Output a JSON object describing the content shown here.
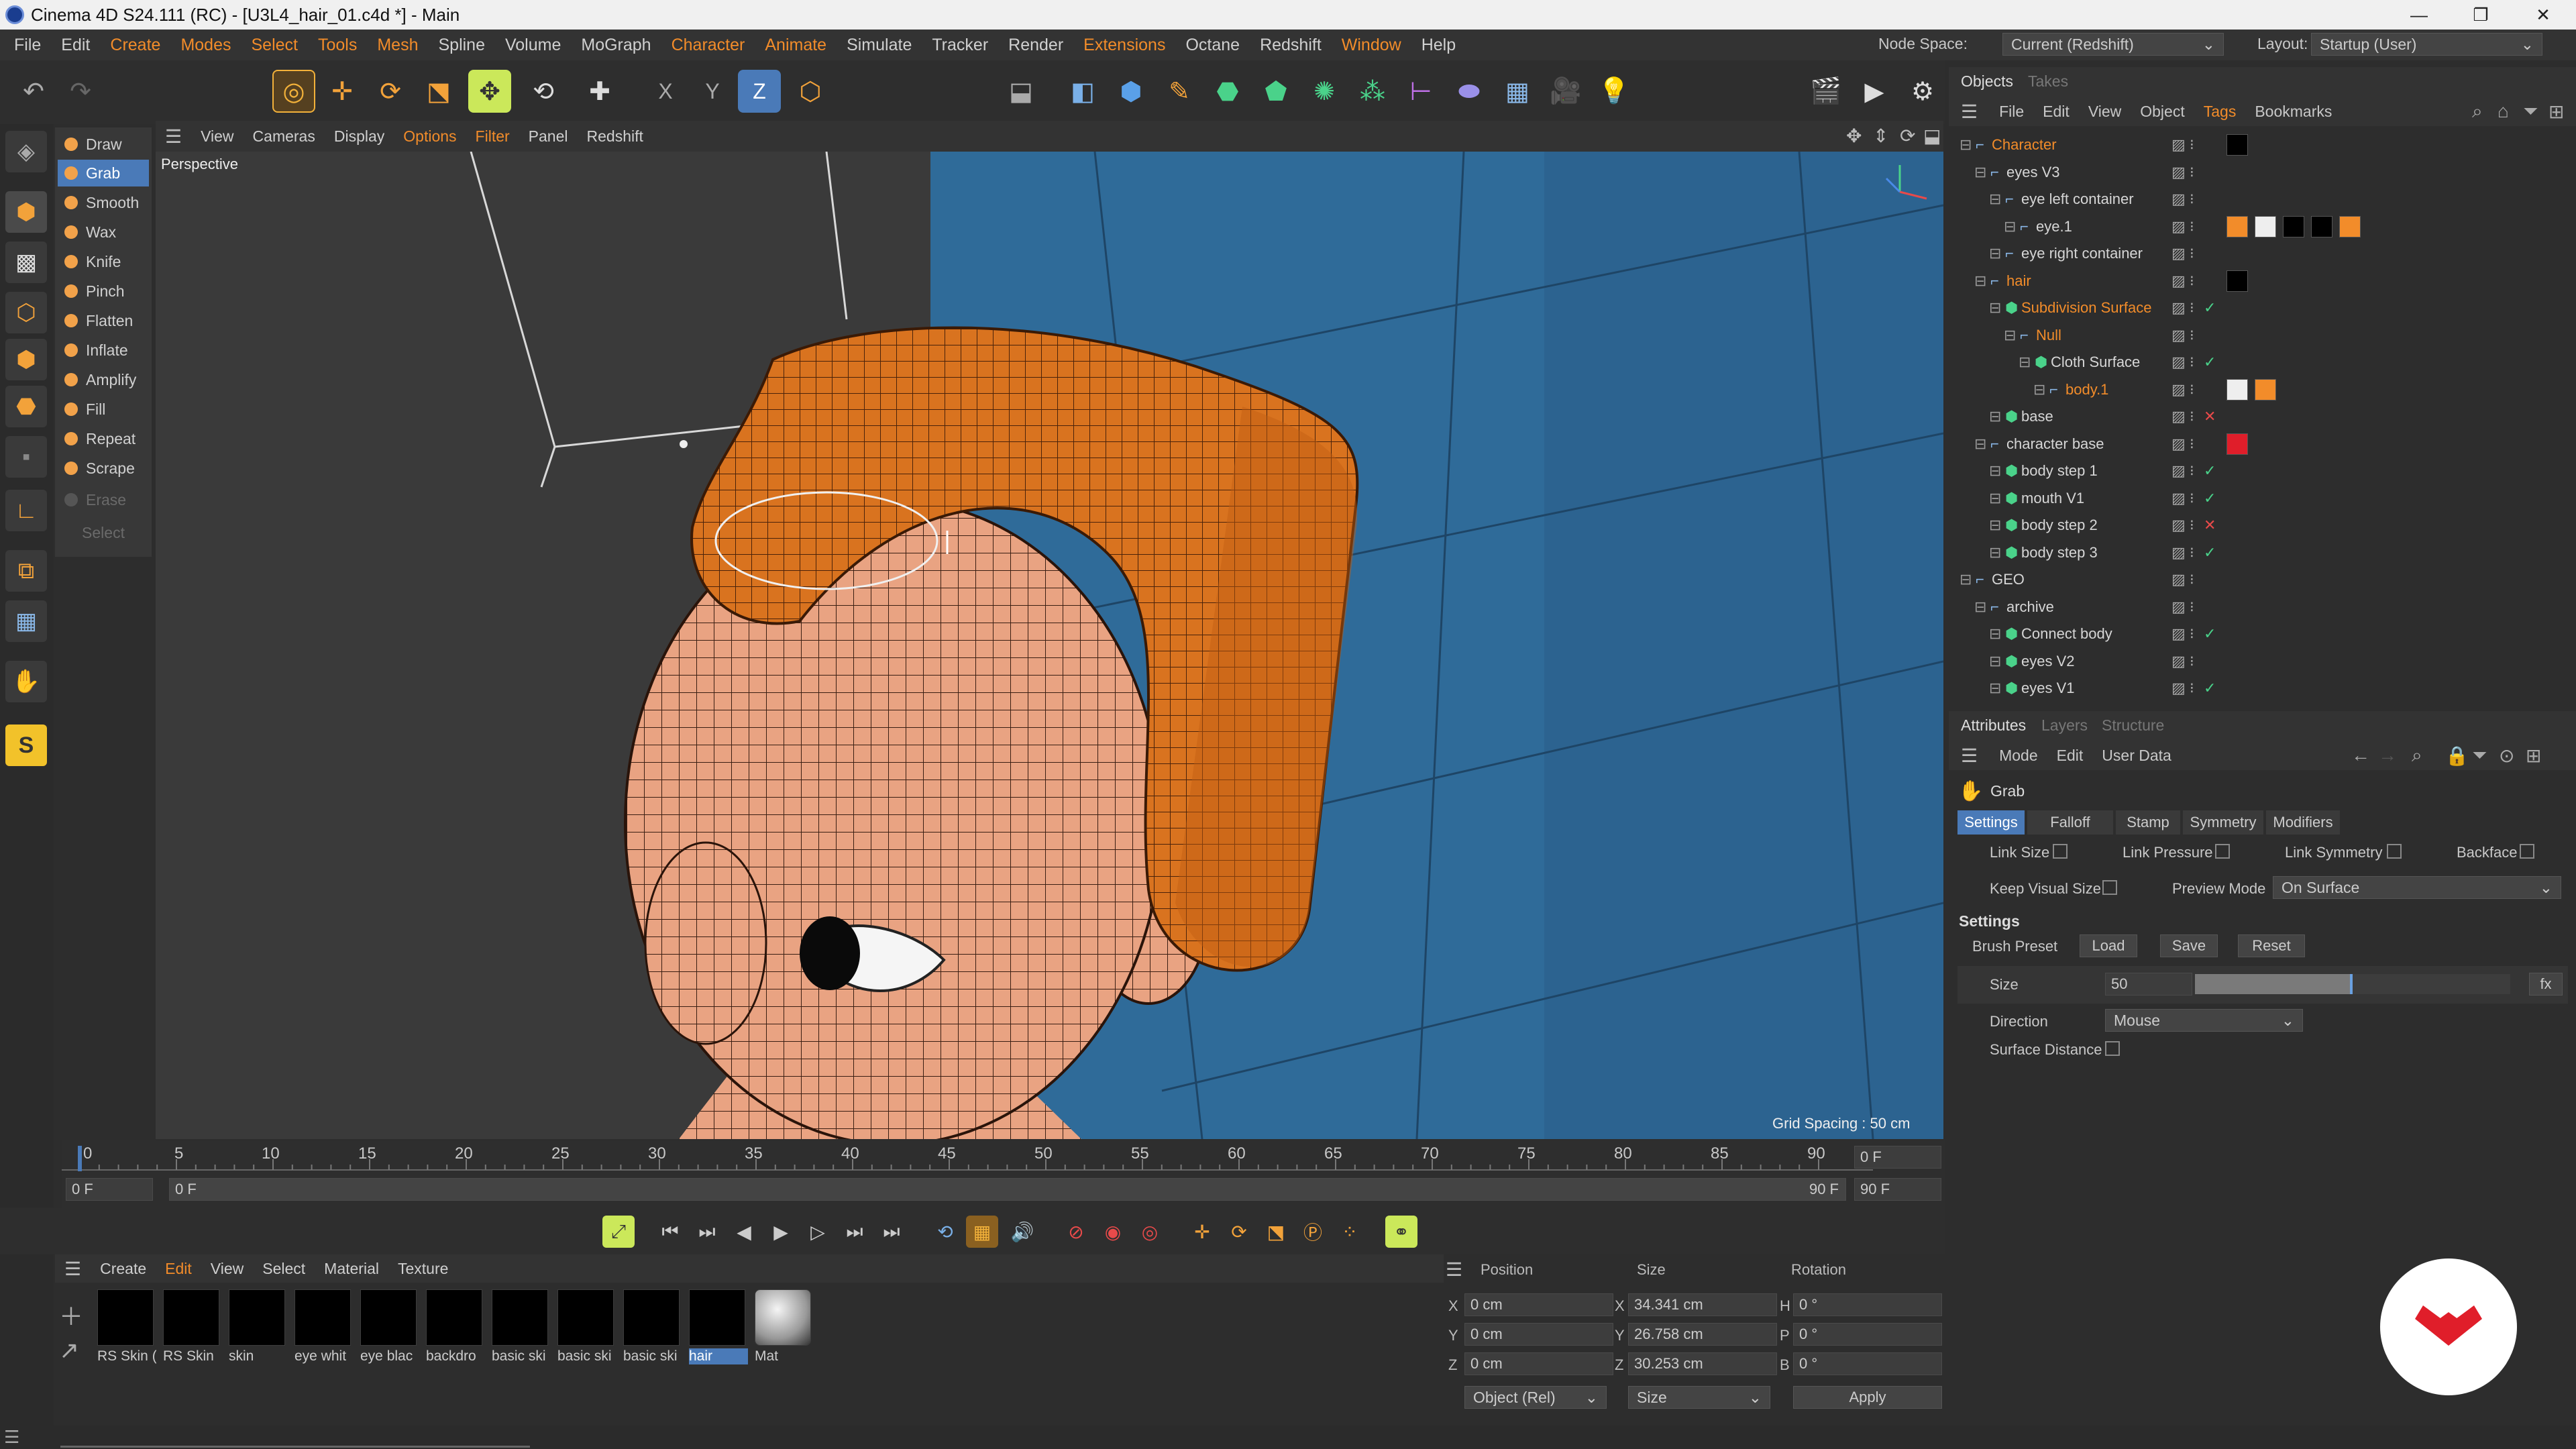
{
  "window": {
    "title": "Cinema 4D S24.111 (RC) - [U3L4_hair_01.c4d *] - Main"
  },
  "menubar": {
    "items": [
      "File",
      "Edit",
      "Create",
      "Modes",
      "Select",
      "Tools",
      "Mesh",
      "Spline",
      "Volume",
      "MoGraph",
      "Character",
      "Animate",
      "Simulate",
      "Tracker",
      "Render",
      "Extensions",
      "Octane",
      "Redshift",
      "Window",
      "Help"
    ],
    "node_space_label": "Node Space:",
    "node_space_value": "Current (Redshift)",
    "layout_label": "Layout:",
    "layout_value": "Startup (User)"
  },
  "toolbar": {
    "x_label": "X",
    "y_label": "Y",
    "z_label": "Z"
  },
  "sculpt_tools": [
    "Draw",
    "Grab",
    "Smooth",
    "Wax",
    "Knife",
    "Pinch",
    "Flatten",
    "Inflate",
    "Amplify",
    "Fill",
    "Repeat",
    "Scrape",
    "Erase",
    "Select"
  ],
  "viewport": {
    "menu": [
      "View",
      "Cameras",
      "Display",
      "Options",
      "Filter",
      "Panel",
      "Redshift"
    ],
    "label": "Perspective",
    "grid_spacing": "Grid Spacing : 50 cm"
  },
  "timeline": {
    "ticks": [
      "0",
      "5",
      "10",
      "15",
      "20",
      "25",
      "30",
      "35",
      "40",
      "45",
      "50",
      "55",
      "60",
      "65",
      "70",
      "75",
      "80",
      "85",
      "90"
    ],
    "current_frame": "0 F",
    "start_field": "0 F",
    "range_start": "0 F",
    "range_end": "90 F",
    "end_field": "90 F",
    "end_frame_right": "0 F"
  },
  "materials": {
    "menu": [
      "Create",
      "Edit",
      "View",
      "Select",
      "Material",
      "Texture"
    ],
    "items": [
      "RS Skin (",
      "RS Skin",
      "skin",
      "eye whit",
      "eye blac",
      "backdro",
      "basic ski",
      "basic ski",
      "basic ski",
      "hair",
      "Mat"
    ]
  },
  "coordinates": {
    "headers": {
      "position": "Position",
      "size": "Size",
      "rotation": "Rotation"
    },
    "x_label": "X",
    "y_label": "Y",
    "z_label": "Z",
    "h_label": "H",
    "p_label": "P",
    "b_label": "B",
    "pos_x": "0 cm",
    "pos_y": "0 cm",
    "pos_z": "0 cm",
    "size_x": "34.341 cm",
    "size_y": "26.758 cm",
    "size_z": "30.253 cm",
    "rot_h": "0 °",
    "rot_p": "0 °",
    "rot_b": "0 °",
    "mode_select": "Object (Rel)",
    "size_select": "Size",
    "apply": "Apply"
  },
  "objects": {
    "tabs": [
      "Objects",
      "Takes"
    ],
    "menu": [
      "File",
      "Edit",
      "View",
      "Object",
      "Tags",
      "Bookmarks"
    ],
    "rows": [
      {
        "name": "Character",
        "level": 0
      },
      {
        "name": "eyes V3",
        "level": 1
      },
      {
        "name": "eye left container",
        "level": 2
      },
      {
        "name": "eye.1",
        "level": 3
      },
      {
        "name": "eye right container",
        "level": 2
      },
      {
        "name": "hair",
        "level": 1
      },
      {
        "name": "Subdivision Surface",
        "level": 2
      },
      {
        "name": "Null",
        "level": 3
      },
      {
        "name": "Cloth Surface",
        "level": 4
      },
      {
        "name": "body.1",
        "level": 5
      },
      {
        "name": "base",
        "level": 2
      },
      {
        "name": "character base",
        "level": 1
      },
      {
        "name": "body step 1",
        "level": 2
      },
      {
        "name": "mouth V1",
        "level": 2
      },
      {
        "name": "body step 2",
        "level": 2
      },
      {
        "name": "body step 3",
        "level": 2
      },
      {
        "name": "GEO",
        "level": 0
      },
      {
        "name": "archive",
        "level": 1
      },
      {
        "name": "Connect body",
        "level": 2
      },
      {
        "name": "eyes V2",
        "level": 2
      },
      {
        "name": "eyes V1",
        "level": 2
      }
    ]
  },
  "attributes": {
    "tabs": [
      "Attributes",
      "Layers",
      "Structure"
    ],
    "menu": [
      "Mode",
      "Edit",
      "User Data"
    ],
    "object_name": "Grab",
    "subtabs": [
      "Settings",
      "Falloff",
      "Stamp",
      "Symmetry",
      "Modifiers"
    ],
    "link_size": "Link Size",
    "link_pressure": "Link Pressure",
    "link_symmetry": "Link Symmetry",
    "backface": "Backface",
    "keep_visual_size": "Keep Visual Size",
    "preview_mode_label": "Preview Mode",
    "preview_mode_value": "On Surface",
    "section": "Settings",
    "brush_preset": "Brush Preset",
    "load": "Load",
    "save": "Save",
    "reset": "Reset",
    "size_label": "Size",
    "size_value": "50",
    "size_fraction": 0.5,
    "fx": "fx",
    "direction_label": "Direction",
    "direction_value": "Mouse",
    "surface_distance": "Surface Distance"
  },
  "colors": {
    "accent": "#4a7ab8",
    "orange": "#f28c2a",
    "hair": "#d4701f",
    "skin": "#e8a07e",
    "backdrop": "#2f6b99"
  }
}
